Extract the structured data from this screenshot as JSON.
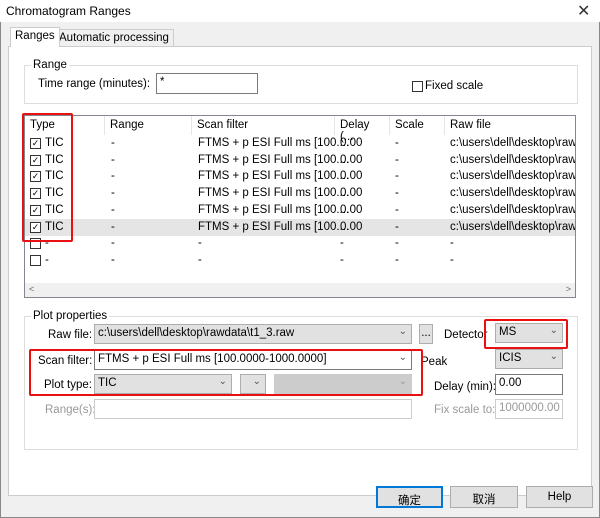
{
  "window": {
    "title": "Chromatogram Ranges",
    "close": "✕"
  },
  "tabs": [
    {
      "label": "Ranges"
    },
    {
      "label": "Automatic processing"
    }
  ],
  "range_group": {
    "legend": "Range",
    "time_label": "Time range (minutes):",
    "time_value": "*",
    "fixed_scale_label": "Fixed scale",
    "fixed_scale_checked": false
  },
  "table": {
    "columns": [
      "Type",
      "Range",
      "Scan filter",
      "Delay (...",
      "Scale",
      "Raw file"
    ],
    "rows": [
      {
        "checked": true,
        "type": "TIC",
        "range": "-",
        "filter": "FTMS + p ESI Full ms [100....",
        "delay": "0.00",
        "scale": "-",
        "raw": "c:\\users\\dell\\desktop\\rawd..."
      },
      {
        "checked": true,
        "type": "TIC",
        "range": "-",
        "filter": "FTMS + p ESI Full ms [100....",
        "delay": "0.00",
        "scale": "-",
        "raw": "c:\\users\\dell\\desktop\\rawd..."
      },
      {
        "checked": true,
        "type": "TIC",
        "range": "-",
        "filter": "FTMS + p ESI Full ms [100....",
        "delay": "0.00",
        "scale": "-",
        "raw": "c:\\users\\dell\\desktop\\rawd..."
      },
      {
        "checked": true,
        "type": "TIC",
        "range": "-",
        "filter": "FTMS + p ESI Full ms [100....",
        "delay": "0.00",
        "scale": "-",
        "raw": "c:\\users\\dell\\desktop\\rawd..."
      },
      {
        "checked": true,
        "type": "TIC",
        "range": "-",
        "filter": "FTMS + p ESI Full ms [100....",
        "delay": "0.00",
        "scale": "-",
        "raw": "c:\\users\\dell\\desktop\\rawd..."
      },
      {
        "checked": true,
        "type": "TIC",
        "range": "-",
        "filter": "FTMS + p ESI Full ms [100....",
        "delay": "0.00",
        "scale": "-",
        "raw": "c:\\users\\dell\\desktop\\rawd...",
        "selected": true
      },
      {
        "checked": false,
        "type": "-",
        "range": "-",
        "filter": "-",
        "delay": "-",
        "scale": "-",
        "raw": "-"
      },
      {
        "checked": false,
        "type": "-",
        "range": "-",
        "filter": "-",
        "delay": "-",
        "scale": "-",
        "raw": "-"
      }
    ]
  },
  "plot": {
    "legend": "Plot properties",
    "raw_file_label": "Raw file:",
    "raw_file_value": "c:\\users\\dell\\desktop\\rawdata\\t1_3.raw",
    "browse": "...",
    "detector_label": "Detector",
    "detector_value": "MS",
    "scan_filter_label": "Scan filter:",
    "scan_filter_value": "FTMS + p ESI Full ms [100.0000-1000.0000]",
    "peak_label": "Peak",
    "peak_value": "ICIS",
    "plot_type_label": "Plot type:",
    "plot_type_value": "TIC",
    "delay_label": "Delay (min):",
    "delay_value": "0.00",
    "ranges_label": "Range(s):",
    "fix_scale_label": "Fix scale to:",
    "fix_scale_value": "1000000.00"
  },
  "buttons": {
    "ok": "确定",
    "cancel": "取消",
    "help": "Help"
  }
}
